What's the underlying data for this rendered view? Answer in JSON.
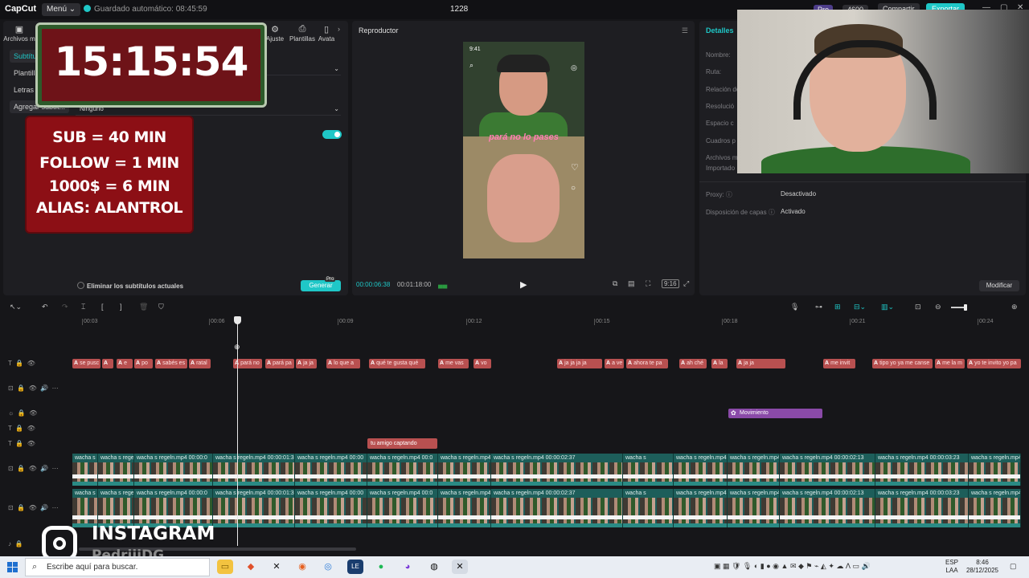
{
  "topbar": {
    "logo": "CapCut",
    "menu_label": "Menú ⌄",
    "autosave": "Guardado automático: 08:45:59",
    "project_name": "1228",
    "pro": "Pro",
    "points": "4600",
    "share": "Compartir",
    "export": "Exportar",
    "win_min": "—",
    "win_max": "▢",
    "win_close": "✕"
  },
  "left_panel": {
    "tabs": [
      {
        "label": "Archivos m",
        "icon": "media-icon"
      },
      {
        "label": "Ajuste",
        "icon": "adjust-icon"
      },
      {
        "label": "Plantillas",
        "icon": "templates-icon"
      },
      {
        "label": "Avata",
        "icon": "avatar-icon"
      }
    ],
    "side_items": [
      "Subtítu",
      "Plantilla",
      "Letras a",
      "Agregar subtít..."
    ],
    "dropdown2_value": "Ninguno",
    "remove_subs_label": "Eliminar los subtítulos actuales",
    "generate_label": "Generar",
    "generate_badge": "Pro"
  },
  "overlay": {
    "clock": "15:15:54",
    "sub_lines": [
      "SUB = 40 MIN",
      "FOLLOW = 1 MIN",
      "1000$ = 6 MIN",
      "ALIAS: ALANTROL"
    ]
  },
  "player": {
    "title": "Reproductor",
    "phone_time": "9:41",
    "caption": "pará no lo pases",
    "current_time": "00:00:06:38",
    "total_time": "00:01:18:00",
    "ratio": "9:16"
  },
  "details": {
    "tab": "Detalles",
    "rows": [
      {
        "label": "Nombre:",
        "value": ""
      },
      {
        "label": "Ruta:",
        "value": ""
      },
      {
        "label": "Relación de",
        "value": ""
      },
      {
        "label": "Resolució",
        "value": ""
      },
      {
        "label": "Espacio c",
        "value": ""
      },
      {
        "label": "Cuadros p",
        "value": ""
      },
      {
        "label": "Archivos m",
        "value": ""
      },
      {
        "label": "Importado",
        "value": ""
      }
    ],
    "proxy_label": "Proxy: ⓘ",
    "proxy_value": "Desactivado",
    "layers_label": "Disposición de capas ⓘ",
    "layers_value": "Activado",
    "modify": "Modificar"
  },
  "timeline": {
    "ticks": [
      "00:03",
      "00:06",
      "00:09",
      "00:12",
      "00:15",
      "00:18",
      "00:21",
      "00:24"
    ],
    "caption_clips": [
      {
        "text": "se pusc"
      },
      {
        "text": ""
      },
      {
        "text": "e"
      },
      {
        "text": "po"
      },
      {
        "text": "sabés es"
      },
      {
        "text": "ratal"
      },
      {
        "text": "pará no"
      },
      {
        "text": "pará pa"
      },
      {
        "text": "ja ja"
      },
      {
        "text": "lo que a"
      },
      {
        "text": "qué te gusta qué"
      },
      {
        "text": "me vas"
      },
      {
        "text": "vo"
      },
      {
        "text": "ja ja ja ja"
      },
      {
        "text": "a ve"
      },
      {
        "text": "ahora te pa"
      },
      {
        "text": "ah ché"
      },
      {
        "text": "la"
      },
      {
        "text": "ja ja"
      },
      {
        "text": "me invit"
      },
      {
        "text": "tipo yo ya me canse"
      },
      {
        "text": "me la m"
      },
      {
        "text": "yo te invito yo pa"
      }
    ],
    "effect_clip": "Movimiento",
    "text_clip": "tu amigo captando",
    "video_clips_1": [
      "wacha s regeln.mp4",
      "wacha s regeln.mp4",
      "wacha s regeln.mp4  00:00:0",
      "wacha s regeln.mp4  00:00:01:3",
      "wacha s regeln.mp4  00:00",
      "wacha s regeln.mp4  00:0",
      "wacha s regeln.mp4",
      "wacha s regeln.mp4  00:00:02:37",
      "wacha s",
      "wacha s regeln.mp4",
      "wacha s regeln.mp4",
      "wacha s regeln.mp4  00:00:02:13",
      "wacha s regeln.mp4  00:00:03:23",
      "wacha s regeln.mp4"
    ],
    "video_clips_2": [
      "wacha s regeln.mp4",
      "wacha s regeln.mp4",
      "wacha s regeln.mp4  00:00:0",
      "wacha s regeln.mp4  00:00:01:3",
      "wacha s regeln.mp4  00:00",
      "wacha s regeln.mp4  00:0",
      "wacha s regeln.mp4",
      "wacha s regeln.mp4  00:00:02:37",
      "wacha s",
      "wacha s regeln.mp4",
      "wacha s regeln.mp4",
      "wacha s regeln.mp4  00:00:02:13",
      "wacha s regeln.mp4  00:00:03:23",
      "wacha s regeln.mp4"
    ]
  },
  "instagram": {
    "title": "INSTAGRAM",
    "handle": "PedriiiDG"
  },
  "taskbar": {
    "search_placeholder": "Escribe aquí para buscar.",
    "lang_top": "ESP",
    "lang_bottom": "LAA",
    "time": "8:46",
    "date": "28/12/2025"
  }
}
